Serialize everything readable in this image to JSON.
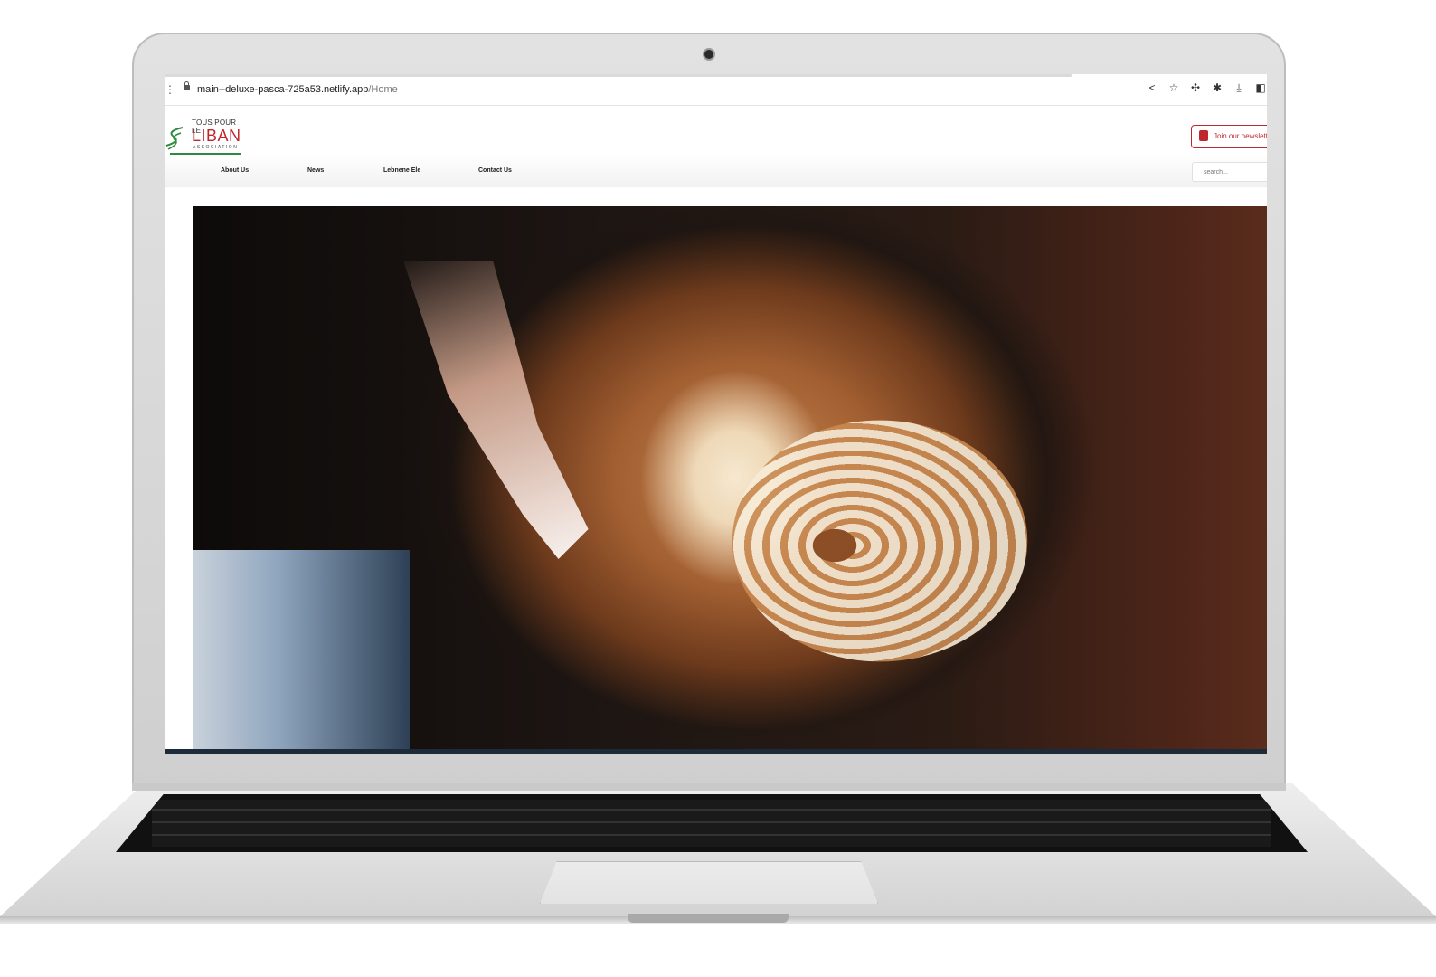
{
  "browser": {
    "url_host": "main--deluxe-pasca-725a53.netlify.app",
    "url_path": "/Home",
    "icons": [
      "share-icon",
      "star-icon",
      "move-icon",
      "extensions-icon",
      "download-icon",
      "sidebar-icon"
    ]
  },
  "site": {
    "logo": {
      "line1": "TOUS POUR LE",
      "line2": "LIBAN",
      "line3": "ASSOCIATION"
    },
    "newsletter_label": "Join our newslett",
    "nav": [
      "About Us",
      "News",
      "Lebnene Ele",
      "Contact Us"
    ],
    "search_placeholder": "search...",
    "colors": {
      "brand_red": "#c0272d",
      "brand_green": "#2e8a3d"
    }
  }
}
